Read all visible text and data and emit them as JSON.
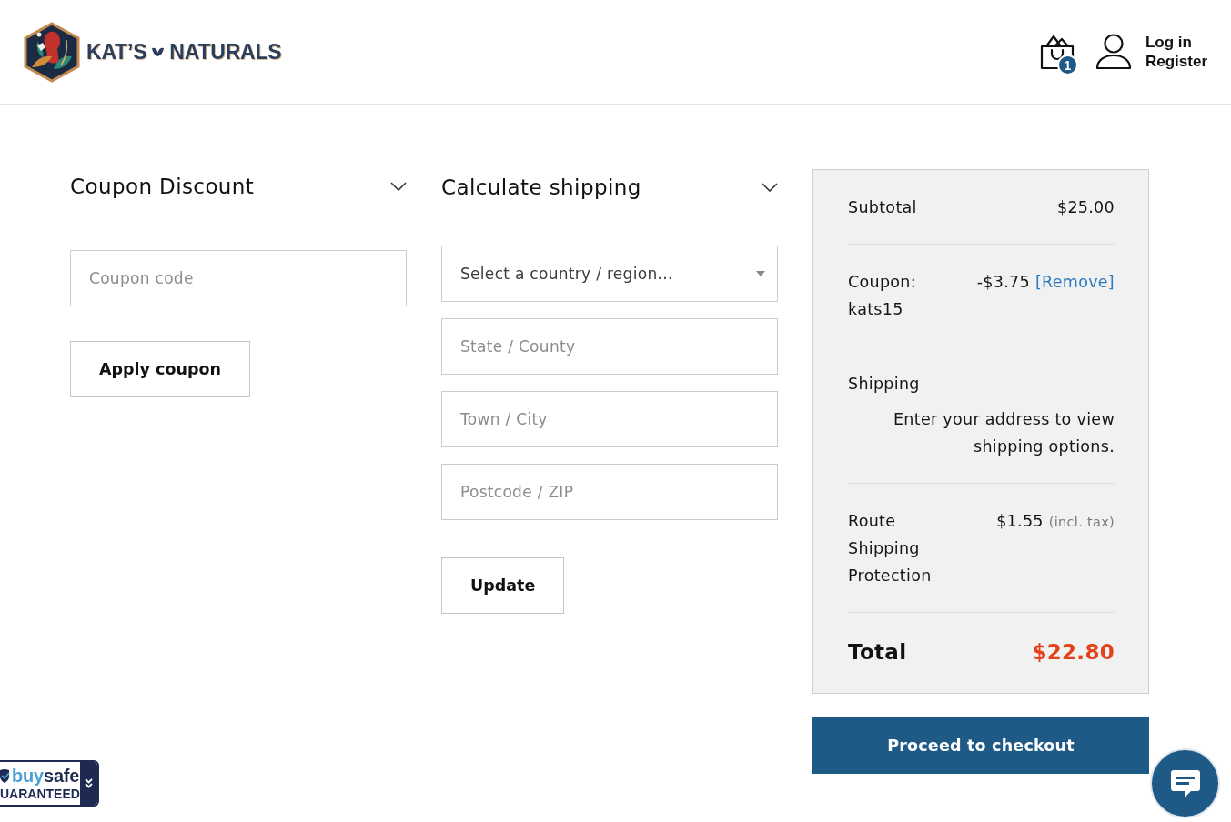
{
  "header": {
    "logo": {
      "word_1": "KAT’S",
      "word_2": "NATURALS"
    },
    "cart": {
      "count": "1"
    },
    "account": {
      "login": "Log in",
      "register": "Register"
    }
  },
  "coupon_panel": {
    "title": "Coupon Discount",
    "field": {
      "placeholder": "Coupon code"
    },
    "button": "Apply coupon"
  },
  "shipping_panel": {
    "title": "Calculate shipping",
    "fields": [
      {
        "kind": "select",
        "value": "Select a country / region..."
      },
      {
        "kind": "text",
        "placeholder": "State / County"
      },
      {
        "kind": "text",
        "placeholder": "Town / City"
      },
      {
        "kind": "text",
        "placeholder": "Postcode / ZIP"
      }
    ],
    "button": "Update"
  },
  "totals": {
    "rows": [
      {
        "kind": "amount",
        "label": "Subtotal",
        "value": "$25.00"
      },
      {
        "kind": "coupon",
        "label": "Coupon: kats15",
        "value": "-$3.75",
        "link": "[Remove]"
      },
      {
        "kind": "shipping",
        "label": "Shipping",
        "note": "Enter your address to view shipping options."
      },
      {
        "kind": "amount",
        "label": "Route Shipping Protection",
        "value": "$1.55",
        "note": "(incl. tax)"
      },
      {
        "kind": "total",
        "label": "Total",
        "value": "$22.80"
      }
    ]
  },
  "checkout_button": "Proceed to checkout",
  "trust_badge": {
    "word_1": "buy",
    "word_2": "safe",
    "caption": "UARANTEED"
  }
}
